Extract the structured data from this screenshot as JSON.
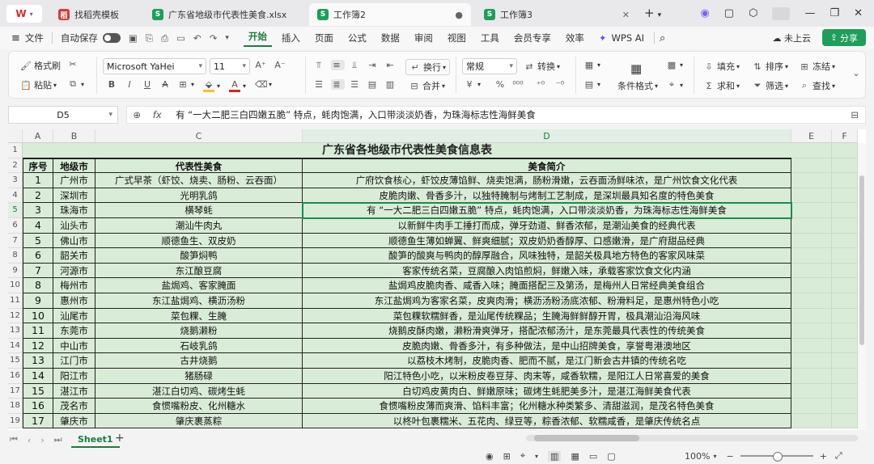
{
  "tabs": {
    "wps": "W",
    "t1": "找稻壳模板",
    "t2": "广东省地级市代表性美食.xlsx",
    "t3": "工作簿2",
    "t4": "工作簿3",
    "plus": "+"
  },
  "menu": {
    "file": "文件",
    "autosave": "自动保存",
    "items": [
      "开始",
      "插入",
      "页面",
      "公式",
      "数据",
      "审阅",
      "视图",
      "工具",
      "会员专享",
      "效率"
    ],
    "wpsai": "WPS AI",
    "cloud": "未上云",
    "share": "分享"
  },
  "ribbon": {
    "format_painter": "格式刷",
    "paste": "粘贴",
    "font_name": "Microsoft YaHei",
    "font_size": "11",
    "wrap": "换行",
    "merge": "合并",
    "num_format": "常规",
    "convert": "转换",
    "cond_format": "条件格式",
    "fill": "填充",
    "sort": "排序",
    "freeze": "冻结",
    "sum": "求和",
    "filter": "筛选",
    "find": "查找"
  },
  "formula": {
    "cell_ref": "D5",
    "content": "有 “一大二肥三白四嫩五脆” 特点，蚝肉饱满，入口带淡淡奶香，为珠海标志性海鲜美食"
  },
  "columns": [
    "A",
    "B",
    "C",
    "D",
    "E",
    "F"
  ],
  "sheet_title": "广东省各地级市代表性美食信息表",
  "headers": [
    "序号",
    "地级市",
    "代表性美食",
    "美食简介"
  ],
  "rows": [
    [
      "1",
      "广州市",
      "广式早茶（虾饺、烧卖、肠粉、云吞面）",
      "广府饮食核心，虾饺皮薄馅鲜、烧卖饱满，肠粉滑嫩，云吞面汤鲜味浓，是广州饮食文化代表"
    ],
    [
      "2",
      "深圳市",
      "光明乳鸽",
      "皮脆肉嫩、骨香多汁，以独特腌制与烤制工艺制成，是深圳最具知名度的特色美食"
    ],
    [
      "3",
      "珠海市",
      "横琴蚝",
      "有 “一大二肥三白四嫩五脆” 特点，蚝肉饱满，入口带淡淡奶香，为珠海标志性海鲜美食"
    ],
    [
      "4",
      "汕头市",
      "潮汕牛肉丸",
      "以新鲜牛肉手工捶打而成，弹牙劲道、鲜香浓郁，是潮汕美食的经典代表"
    ],
    [
      "5",
      "佛山市",
      "顺德鱼生、双皮奶",
      "顺德鱼生薄如蝉翼、鲜爽细腻；双皮奶奶香醇厚、口感嫩滑，是广府甜品经典"
    ],
    [
      "6",
      "韶关市",
      "酸笋焖鸭",
      "酸笋的酸爽与鸭肉的醇厚融合，风味独特，是韶关极具地方特色的客家风味菜"
    ],
    [
      "7",
      "河源市",
      "东江酿豆腐",
      "客家传统名菜，豆腐酿入肉馅煎焖，鲜嫩入味，承载客家饮食文化内涵"
    ],
    [
      "8",
      "梅州市",
      "盐焗鸡、客家腌面",
      "盐焗鸡皮脆肉香、咸香入味；腌面搭配三及第汤，是梅州人日常经典美食组合"
    ],
    [
      "9",
      "惠州市",
      "东江盐焗鸡、横沥汤粉",
      "东江盐焗鸡为客家名菜，皮爽肉滑；横沥汤粉汤底浓郁、粉滑料足，是惠州特色小吃"
    ],
    [
      "10",
      "汕尾市",
      "菜包粿、生腌",
      "菜包粿软糯鲜香，是汕尾传统粿品；生腌海鲜鲜醇开胃，极具潮汕沿海风味"
    ],
    [
      "11",
      "东莞市",
      "烧鹅濑粉",
      "烧鹅皮酥肉嫩，濑粉滑爽弹牙，搭配浓郁汤汁，是东莞最具代表性的传统美食"
    ],
    [
      "12",
      "中山市",
      "石岐乳鸽",
      "皮脆肉嫩、骨香多汁，有多种做法，是中山招牌美食，享誉粤港澳地区"
    ],
    [
      "13",
      "江门市",
      "古井烧鹅",
      "以荔枝木烤制，皮脆肉香、肥而不腻，是江门新会古井镇的传统名吃"
    ],
    [
      "14",
      "阳江市",
      "猪肠碌",
      "阳江特色小吃，以米粉皮卷豆芽、肉末等，咸香软糯，是阳江人日常喜爱的美食"
    ],
    [
      "15",
      "湛江市",
      "湛江白切鸡、碳烤生蚝",
      "白切鸡皮黄肉白、鲜嫩原味；碳烤生蚝肥美多汁，是湛江海鲜美食代表"
    ],
    [
      "16",
      "茂名市",
      "食惯嘴粉皮、化州糖水",
      "食惯嘴粉皮薄而爽滑、馅料丰富；化州糖水种类繁多、清甜滋润，是茂名特色美食"
    ],
    [
      "17",
      "肇庆市",
      "肇庆裹蒸粽",
      "以柊叶包裹糯米、五花肉、绿豆等，粽香浓郁、软糯咸香，是肇庆传统名点"
    ]
  ],
  "row_numbers": [
    "1",
    "2",
    "3",
    "4",
    "5",
    "6",
    "7",
    "8",
    "9",
    "10",
    "11",
    "12",
    "13",
    "14",
    "15",
    "16",
    "17",
    "18",
    "19"
  ],
  "sheet_tab": "Sheet1",
  "zoom": "100%",
  "colors": {
    "cell_bg": "#d9ecd7",
    "accent": "#1a7d3c",
    "share_bg": "#1e9e5a"
  }
}
